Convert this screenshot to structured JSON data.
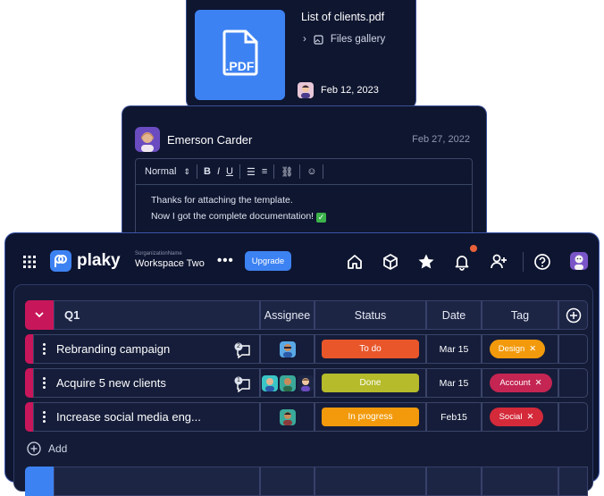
{
  "file_card": {
    "file_name": "List of clients.pdf",
    "thumb_label": ".PDF",
    "folder": "Files gallery",
    "date": "Feb 12, 2023"
  },
  "comment_card": {
    "author": "Emerson Carder",
    "date": "Feb 27, 2022",
    "toolbar": {
      "style_select": "Normal",
      "bold": "B",
      "italic": "I",
      "underline": "U"
    },
    "line1": "Thanks for attaching the template.",
    "line2": "Now I got the complete documentation!"
  },
  "app": {
    "logo": "plaky",
    "workspace_small": "SorganizationName",
    "workspace_name": "Workspace Two",
    "upgrade_label": "Upgrade",
    "more_label": "•••"
  },
  "board": {
    "group_name": "Q1",
    "columns": [
      "Assignee",
      "Status",
      "Date",
      "Tag"
    ],
    "add_label": "Add",
    "tasks": [
      {
        "name": "Rebranding campaign",
        "comments": "2",
        "status": "To do",
        "status_color": "#e8562a",
        "date": "Mar 15",
        "tag": "Design",
        "tag_color": "#f29a0c"
      },
      {
        "name": "Acquire 5 new clients",
        "comments": "1",
        "status": "Done",
        "status_color": "#b5bb2a",
        "date": "Mar 15",
        "tag": "Account",
        "tag_color": "#c42552"
      },
      {
        "name": "Increase social media eng...",
        "comments": "",
        "status": "In progress",
        "status_color": "#f29a0c",
        "date": "Feb15",
        "tag": "Social",
        "tag_color": "#d42a3a"
      }
    ]
  },
  "colors": {
    "accent": "#3d82f2",
    "group": "#c8165a",
    "background": "#0e1530"
  }
}
